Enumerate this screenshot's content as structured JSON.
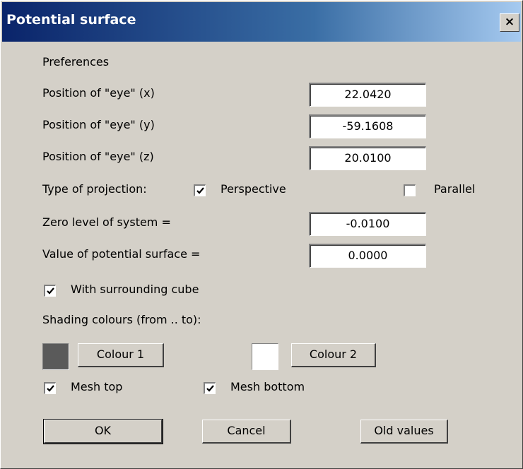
{
  "window": {
    "title": "Potential surface",
    "close_label": "×"
  },
  "preferences": {
    "heading": "Preferences",
    "eye_x": {
      "label": "Position of \"eye\" (x)",
      "value": "22.0420"
    },
    "eye_y": {
      "label": "Position of \"eye\" (y)",
      "value": "-59.1608"
    },
    "eye_z": {
      "label": "Position of \"eye\" (z)",
      "value": "20.0100"
    },
    "projection": {
      "label": "Type of projection:",
      "perspective": {
        "label": "Perspective",
        "checked": true
      },
      "parallel": {
        "label": "Parallel",
        "checked": false
      }
    },
    "zero_level": {
      "label": "Zero level of system =",
      "value": "-0.0100"
    },
    "potential_value": {
      "label": "Value of potential surface =",
      "value": "0.0000"
    },
    "surrounding_cube": {
      "label": "With surrounding cube",
      "checked": true
    },
    "shading_label": "Shading colours (from .. to):",
    "colour1": {
      "button": "Colour 1",
      "swatch": "#5a5a5a"
    },
    "colour2": {
      "button": "Colour 2",
      "swatch": "#ffffff"
    },
    "mesh_top": {
      "label": "Mesh top",
      "checked": true
    },
    "mesh_bottom": {
      "label": "Mesh bottom",
      "checked": true
    }
  },
  "buttons": {
    "ok": "OK",
    "cancel": "Cancel",
    "old_values": "Old values"
  }
}
